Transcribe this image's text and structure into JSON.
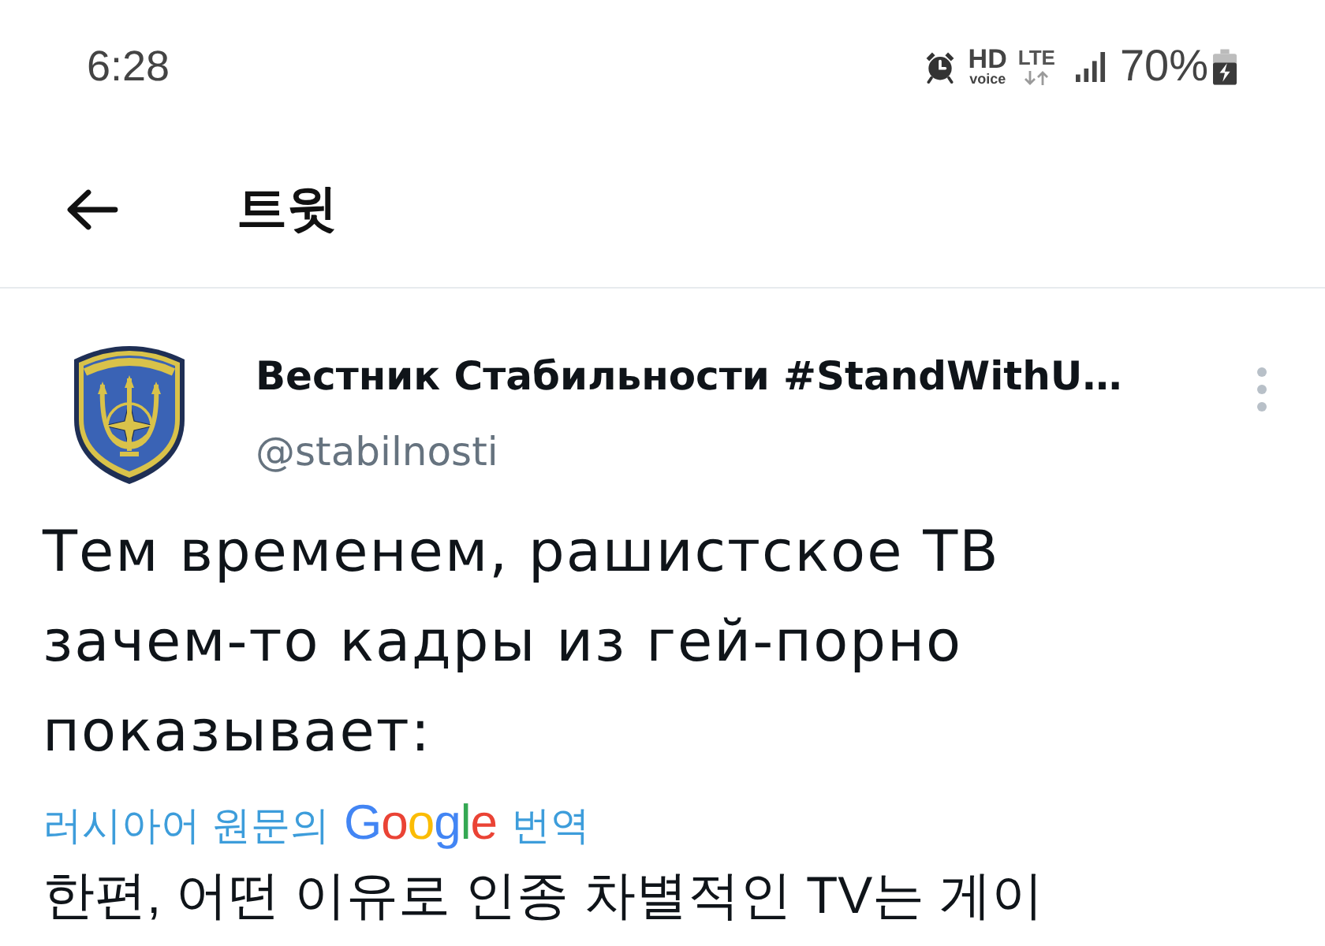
{
  "status_bar": {
    "time": "6:28",
    "hd_label": "HD",
    "voice_label": "voice",
    "network": "LTE",
    "battery": "70%"
  },
  "header": {
    "title": "트윗"
  },
  "tweet": {
    "author": {
      "name": "Вестник Стабильности #StandWithU…",
      "handle": "@stabilnosti"
    },
    "text": "Тем временем, рашистское ТВ зачем-то кадры из гей-порно показывает:",
    "translation": {
      "prefix": "러시아어 원문의",
      "brand": "Google",
      "suffix": "번역"
    },
    "translated_text": "한편, 어떤 이유로 인종 차별적인 TV는 게이"
  }
}
